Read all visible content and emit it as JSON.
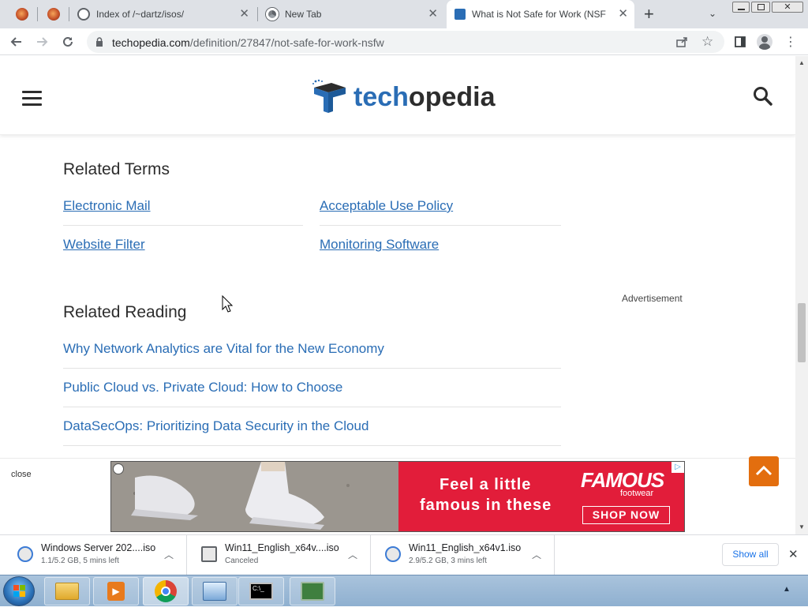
{
  "browser": {
    "tabs": [
      {
        "title": ""
      },
      {
        "title": ""
      },
      {
        "title": "Index of /~dartz/isos/"
      },
      {
        "title": "New Tab"
      },
      {
        "title": "What is Not Safe for Work (NSFW)?"
      }
    ],
    "new_tab_symbol": "+",
    "url_domain": "techopedia.com",
    "url_path": "/definition/27847/not-safe-for-work-nsfw"
  },
  "site": {
    "logo_part1": "tech",
    "logo_part2": "opedia",
    "brand_blue": "#2a6db5",
    "brand_dark": "#2d2d2d"
  },
  "related_terms": {
    "heading": "Related Terms",
    "links": [
      "Electronic Mail",
      "Acceptable Use Policy",
      "Website Filter",
      "Monitoring Software"
    ]
  },
  "related_reading": {
    "heading": "Related Reading",
    "links": [
      "Why Network Analytics are Vital for the New Economy",
      "Public Cloud vs. Private Cloud: How to Choose",
      "DataSecOps: Prioritizing Data Security in the Cloud"
    ]
  },
  "advertisement_label": "Advertisement",
  "ad_close": "close",
  "ad": {
    "headline_line1": "Feel a little",
    "headline_line2": "famous in these",
    "brand": "FAMOUS",
    "brand_sub": "footwear",
    "cta": "SHOP NOW"
  },
  "downloads": [
    {
      "name": "Windows Server 202....iso",
      "status": "1.1/5.2 GB, 5 mins left"
    },
    {
      "name": "Win11_English_x64v....iso",
      "status": "Canceled"
    },
    {
      "name": "Win11_English_x64v1.iso",
      "status": "2.9/5.2 GB, 3 mins left"
    }
  ],
  "show_all": "Show all"
}
